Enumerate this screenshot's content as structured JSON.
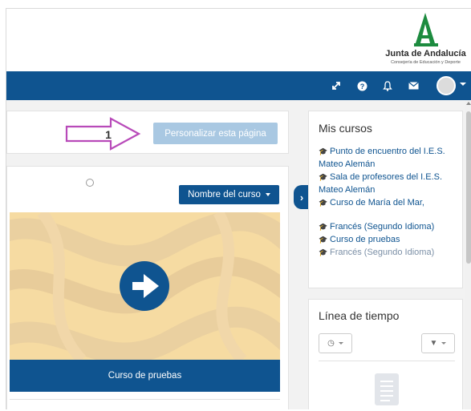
{
  "brand": {
    "name": "Junta de Andalucía",
    "subtitle": "Consejería de Educación y Deporte",
    "color": "#1d8b3f"
  },
  "navbar": {
    "color": "#0f5490",
    "icons": [
      "expand-icon",
      "help-icon",
      "bell-icon",
      "mail-icon",
      "user-avatar"
    ]
  },
  "toolbar": {
    "customize_label": "Personalizar esta página",
    "annotation_number": "1"
  },
  "course_overview": {
    "sort_label": "Nombre del curso",
    "course_name": "Curso de pruebas"
  },
  "mis_cursos": {
    "title": "Mis cursos",
    "courses": [
      {
        "label": "Punto de encuentro del I.E.S. Mateo Alemán",
        "icon": "graduation-cap-icon"
      },
      {
        "label": "Sala de profesores del I.E.S. Mateo Alemán",
        "icon": "graduation-cap-icon"
      },
      {
        "label": "Curso de María del Mar,",
        "icon": "graduation-cap-icon"
      },
      {
        "label": "Francés (Segundo Idioma)",
        "icon": "graduation-cap-icon"
      },
      {
        "label": "Curso de pruebas",
        "icon": "graduation-cap-icon"
      },
      {
        "label": "Francés (Segundo Idioma)",
        "icon": "graduation-cap-icon"
      }
    ]
  },
  "timeline": {
    "title": "Línea de tiempo"
  }
}
